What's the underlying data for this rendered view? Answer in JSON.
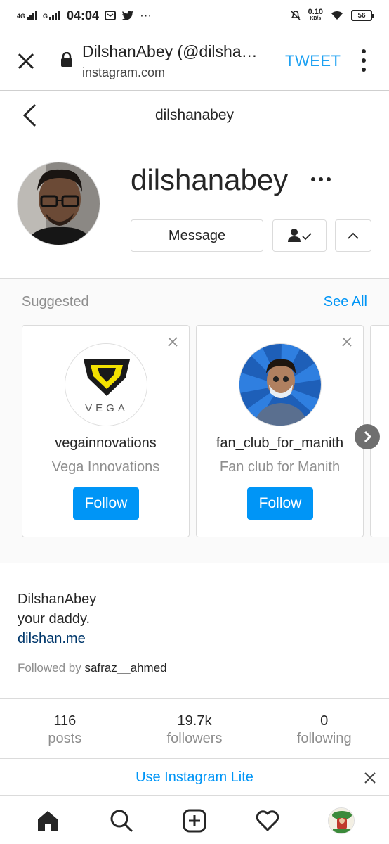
{
  "status_bar": {
    "net1": "4G",
    "net2": "G",
    "time": "04:04",
    "speed": "0.10",
    "speed_unit": "KB/s",
    "battery": "56"
  },
  "browser": {
    "title": "DilshanAbey (@dilshanabey)",
    "url": "instagram.com",
    "tweet_label": "TWEET"
  },
  "header": {
    "title": "dilshanabey"
  },
  "profile": {
    "username": "dilshanabey",
    "message_label": "Message"
  },
  "suggested": {
    "label": "Suggested",
    "see_all": "See All",
    "cards": [
      {
        "username": "vegainnovations",
        "name": "Vega Innovations",
        "follow": "Follow",
        "logo_text": "VEGA"
      },
      {
        "username": "fan_club_for_manith",
        "name": "Fan club for Manith",
        "follow": "Follow"
      }
    ]
  },
  "bio": {
    "name": "DilshanAbey",
    "text": "your daddy.",
    "link": "dilshan.me",
    "followed_prefix": "Followed by ",
    "followed_user": "safraz__ahmed"
  },
  "stats": [
    {
      "value": "116",
      "label": "posts"
    },
    {
      "value": "19.7k",
      "label": "followers"
    },
    {
      "value": "0",
      "label": "following"
    }
  ],
  "lite_banner": {
    "text": "Use Instagram Lite"
  },
  "colors": {
    "accent": "#0095f6",
    "tweet": "#1da1f2",
    "border": "#dbdbdb",
    "muted": "#8e8e8e"
  }
}
